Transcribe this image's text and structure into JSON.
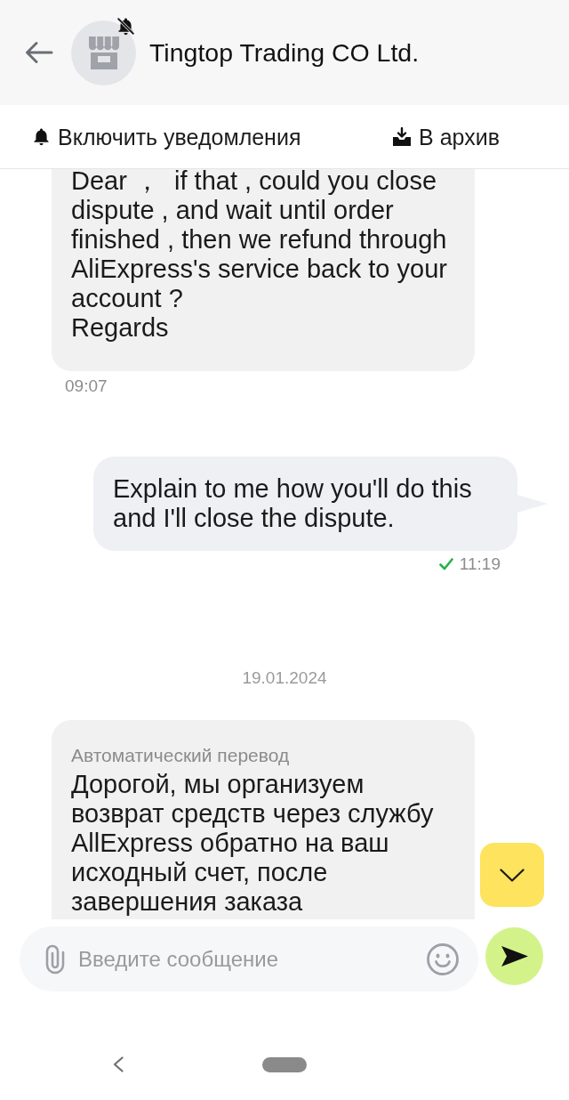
{
  "header": {
    "title": "Tingtop Trading CO Ltd.",
    "muted": true
  },
  "actions": [
    {
      "kind": "notifications",
      "label": "Включить уведомления"
    },
    {
      "kind": "archive",
      "label": "В архив"
    }
  ],
  "messages": [
    {
      "kind": "incoming",
      "text": "Dear ，  if that , could you close dispute , and wait until order finished , then we refund through AliExpress's service back to your account ?\nRegards",
      "time": "09:07"
    },
    {
      "kind": "outgoing",
      "text": "Explain to me how you'll do this and I'll close the dispute.",
      "time": "11:19",
      "read": true
    },
    {
      "kind": "date",
      "text": "19.01.2024"
    },
    {
      "kind": "incoming",
      "note": "Автоматический перевод",
      "text": "Дорогой, мы организуем возврат средств через службу AllExpress обратно на ваш исходный счет, после завершения заказа"
    }
  ],
  "composer": {
    "placeholder": "Введите сообщение"
  }
}
